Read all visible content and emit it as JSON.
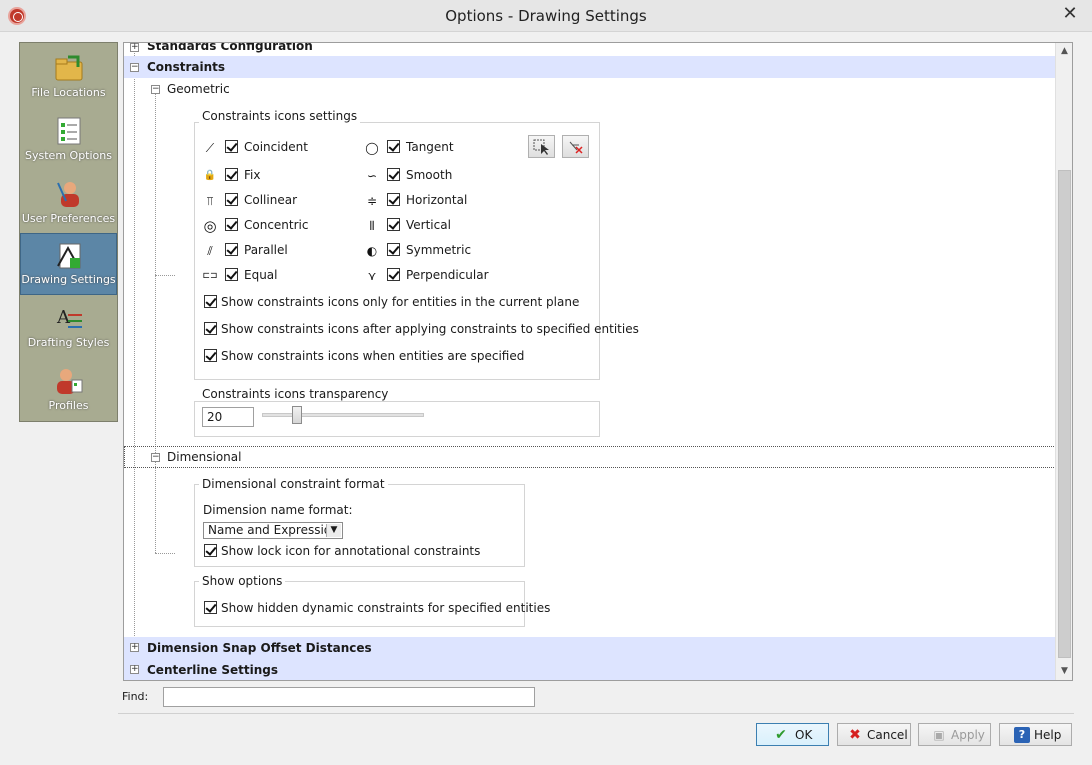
{
  "window": {
    "title": "Options - Drawing Settings"
  },
  "nav": {
    "items": [
      {
        "label": "File Locations"
      },
      {
        "label": "System Options"
      },
      {
        "label": "User Preferences"
      },
      {
        "label": "Drawing Settings"
      },
      {
        "label": "Drafting Styles"
      },
      {
        "label": "Profiles"
      }
    ],
    "active": "Drawing Settings"
  },
  "tree": {
    "standards": "Standards Configuration",
    "constraints": "Constraints",
    "geometric": "Geometric",
    "dimensional": "Dimensional",
    "snap": "Dimension Snap Offset Distances",
    "centerline": "Centerline Settings"
  },
  "icons_group": {
    "title": "Constraints icons settings",
    "left": [
      {
        "label": "Coincident",
        "icon": "coincident-icon",
        "glyph": "⟋"
      },
      {
        "label": "Fix",
        "icon": "lock-icon",
        "glyph": "🔒"
      },
      {
        "label": "Collinear",
        "icon": "collinear-icon",
        "glyph": "⫪"
      },
      {
        "label": "Concentric",
        "icon": "concentric-icon",
        "glyph": "◎"
      },
      {
        "label": "Parallel",
        "icon": "parallel-icon",
        "glyph": "⫽"
      },
      {
        "label": "Equal",
        "icon": "equal-icon",
        "glyph": "⊏⊐"
      }
    ],
    "right": [
      {
        "label": "Tangent",
        "icon": "tangent-icon",
        "glyph": "◯"
      },
      {
        "label": "Smooth",
        "icon": "smooth-icon",
        "glyph": "∽"
      },
      {
        "label": "Horizontal",
        "icon": "horizontal-icon",
        "glyph": "≑"
      },
      {
        "label": "Vertical",
        "icon": "vertical-icon",
        "glyph": "⫴"
      },
      {
        "label": "Symmetric",
        "icon": "symmetric-icon",
        "glyph": "◐"
      },
      {
        "label": "Perpendicular",
        "icon": "perpendicular-icon",
        "glyph": "⋎"
      }
    ],
    "options": [
      "Show constraints icons only for entities in the current plane",
      "Show constraints icons after applying constraints to specified entities",
      "Show constraints icons when entities are specified"
    ]
  },
  "transparency": {
    "title": "Constraints icons transparency",
    "value": "20",
    "level": 20
  },
  "dimensional_format": {
    "title": "Dimensional constraint format",
    "name_format_label": "Dimension name format:",
    "name_format_value": "Name and Expression",
    "lock_option": "Show lock icon for annotational constraints"
  },
  "show_options": {
    "title": "Show options",
    "hidden_option": "Show hidden dynamic constraints for specified entities"
  },
  "find": {
    "label": "Find:",
    "value": ""
  },
  "buttons": {
    "ok": "OK",
    "cancel": "Cancel",
    "apply": "Apply",
    "help": "Help"
  },
  "colors": {
    "nav_bg": "#a8ab91",
    "nav_active": "#5c86a6",
    "row_highlight": "#dde4ff"
  }
}
